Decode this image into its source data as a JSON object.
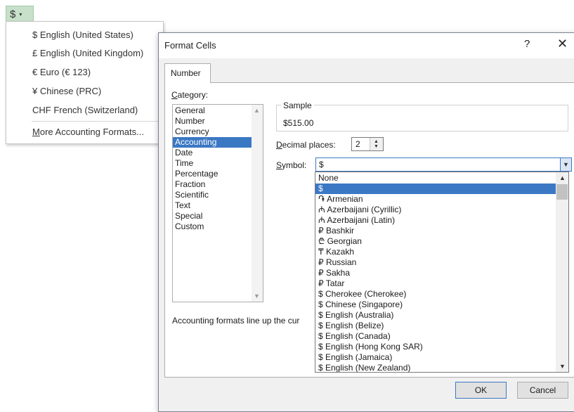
{
  "accounting_button": {
    "symbol": "$",
    "chevron": "▾"
  },
  "accounting_menu": {
    "items": [
      "$ English (United States)",
      "£ English (United Kingdom)",
      "€ Euro (€ 123)",
      "¥ Chinese (PRC)",
      "CHF French (Switzerland)"
    ],
    "more": "More Accounting Formats..."
  },
  "dialog": {
    "title": "Format Cells",
    "help": "?",
    "close": "✕",
    "tab": "Number",
    "category_label": "Category:",
    "categories": [
      "General",
      "Number",
      "Currency",
      "Accounting",
      "Date",
      "Time",
      "Percentage",
      "Fraction",
      "Scientific",
      "Text",
      "Special",
      "Custom"
    ],
    "selected_category": "Accounting",
    "sample_label": "Sample",
    "sample_value": "$515.00",
    "decimal_label": "Decimal places:",
    "decimal_value": "2",
    "symbol_label": "Symbol:",
    "symbol_value": "$",
    "description": "Accounting formats line up the cur",
    "ok": "OK",
    "cancel": "Cancel"
  },
  "symbol_list": {
    "items": [
      "None",
      "$",
      "֏ Armenian",
      "₼ Azerbaijani (Cyrillic)",
      "₼ Azerbaijani (Latin)",
      "₽ Bashkir",
      "₾ Georgian",
      "₸ Kazakh",
      "₽ Russian",
      "₽ Sakha",
      "₽ Tatar",
      "$ Cherokee (Cherokee)",
      "$ Chinese (Singapore)",
      "$ English (Australia)",
      "$ English (Belize)",
      "$ English (Canada)",
      "$ English (Hong Kong SAR)",
      "$ English (Jamaica)",
      "$ English (New Zealand)"
    ],
    "selected": "$"
  }
}
